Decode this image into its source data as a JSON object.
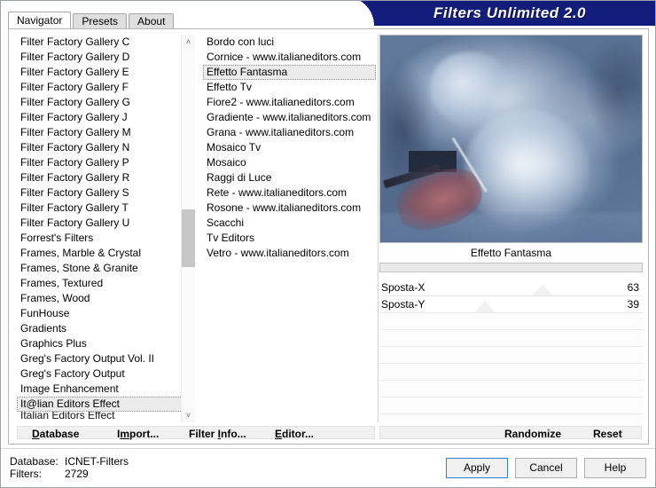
{
  "window": {
    "banner_title": "Filters Unlimited 2.0"
  },
  "tabs": [
    {
      "label": "Navigator",
      "active": true
    },
    {
      "label": "Presets",
      "active": false
    },
    {
      "label": "About",
      "active": false
    }
  ],
  "category_list": {
    "selected": "It@lian Editors Effect",
    "items": [
      "Filter Factory Gallery C",
      "Filter Factory Gallery D",
      "Filter Factory Gallery E",
      "Filter Factory Gallery F",
      "Filter Factory Gallery G",
      "Filter Factory Gallery J",
      "Filter Factory Gallery M",
      "Filter Factory Gallery N",
      "Filter Factory Gallery P",
      "Filter Factory Gallery R",
      "Filter Factory Gallery S",
      "Filter Factory Gallery T",
      "Filter Factory Gallery U",
      "Forrest's Filters",
      "Frames, Marble & Crystal",
      "Frames, Stone & Granite",
      "Frames, Textured",
      "Frames, Wood",
      "FunHouse",
      "Gradients",
      "Graphics Plus",
      "Greg's Factory Output Vol. II",
      "Greg's Factory Output",
      "Image Enhancement",
      "It@lian Editors Effect",
      "Italian Editors Effect"
    ]
  },
  "filter_list": {
    "selected": "Effetto Fantasma",
    "items": [
      "Bordo con luci",
      "Cornice - www.italianeditors.com",
      "Effetto Fantasma",
      "Effetto Tv",
      "Fiore2 - www.italianeditors.com",
      "Gradiente - www.italianeditors.com",
      "Grana - www.italianeditors.com",
      "Mosaico Tv",
      "Mosaico",
      "Raggi di Luce",
      "Rete - www.italianeditors.com",
      "Rosone - www.italianeditors.com",
      "Scacchi",
      "Tv Editors",
      "Vetro - www.italianeditors.com"
    ]
  },
  "preview": {
    "caption": "Effetto Fantasma"
  },
  "parameters": [
    {
      "label": "Sposta-X",
      "value": "63",
      "percent": 63
    },
    {
      "label": "Sposta-Y",
      "value": "39",
      "percent": 39
    }
  ],
  "action_bar": {
    "left_buttons": [
      {
        "label": "Database",
        "accel_index": 0
      },
      {
        "label": "Import...",
        "accel_index": 1
      },
      {
        "label": "Filter Info...",
        "accel_index": 7
      },
      {
        "label": "Editor...",
        "accel_index": 0
      }
    ],
    "right_buttons": [
      {
        "label": "Randomize"
      },
      {
        "label": "Reset"
      }
    ]
  },
  "status": {
    "database_key": "Database:",
    "database_value": "ICNET-Filters",
    "filters_key": "Filters:",
    "filters_value": "2729"
  },
  "dialog_buttons": [
    {
      "label": "Apply",
      "default": true
    },
    {
      "label": "Cancel",
      "default": false
    },
    {
      "label": "Help",
      "default": false
    }
  ],
  "icons": {
    "scroll_up": "˄",
    "scroll_down": "˅"
  },
  "colors": {
    "banner": "#131e7c",
    "selection": "#ebebeb",
    "default_button_border": "#2f7fd0"
  }
}
